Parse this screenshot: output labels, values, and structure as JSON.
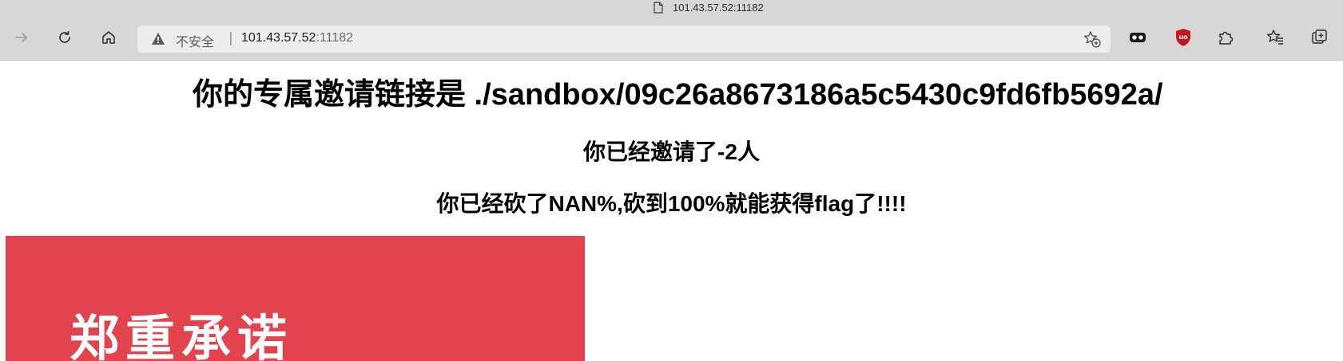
{
  "window": {
    "title": "101.43.57.52:11182"
  },
  "toolbar": {
    "icons": [
      "forward-icon",
      "reload-icon",
      "home-icon",
      "collections-icon",
      "ublock-icon",
      "extensions-icon",
      "favorites-icon",
      "tab-actions-icon"
    ]
  },
  "address_bar": {
    "security_label": "不安全",
    "separator": "|",
    "url_host": "101.43.57.52",
    "url_port": ":11182"
  },
  "page": {
    "invite_heading": "你的专属邀请链接是 ./sandbox/09c26a8673186a5c5430c9fd6fb5692a/",
    "invited_count_heading": "你已经邀请了-2人",
    "progress_heading": "你已经砍了NAN%,砍到100%就能获得flag了!!!!",
    "banner_text": "郑重承诺"
  },
  "colors": {
    "chrome_bg": "#d9d6d6",
    "omnibox_bg": "#efedec",
    "banner_bg": "#e3424f",
    "ublock_red": "#c4161c"
  }
}
